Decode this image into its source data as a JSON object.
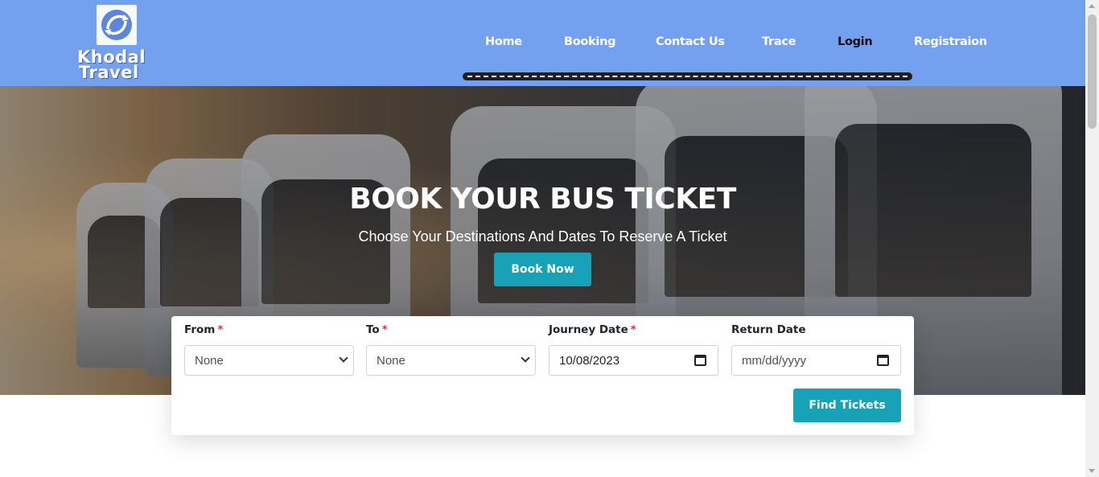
{
  "brand": {
    "name_line1": "Khodal",
    "name_line2": "Travel",
    "logo_icon": "swirl-arrows-icon"
  },
  "nav": {
    "items": [
      {
        "label": "Home"
      },
      {
        "label": "Booking"
      },
      {
        "label": "Contact Us"
      },
      {
        "label": "Trace"
      },
      {
        "label": "Login",
        "active": true
      },
      {
        "label": "Registraion"
      }
    ]
  },
  "hero": {
    "title": "BOOK YOUR BUS TICKET",
    "subtitle": "Choose Your Destinations And Dates To Reserve A Ticket",
    "cta_label": "Book Now"
  },
  "search": {
    "from": {
      "label": "From",
      "required_mark": "*",
      "value": "None"
    },
    "to": {
      "label": "To",
      "required_mark": "*",
      "value": "None"
    },
    "journey_date": {
      "label": "Journey Date",
      "required_mark": "*",
      "value": "10/08/2023"
    },
    "return_date": {
      "label": "Return Date",
      "value": "mm/dd/yyyy"
    },
    "submit_label": "Find Tickets"
  },
  "colors": {
    "header_bg": "#74a0f0",
    "accent": "#17a2b8",
    "required": "#dc3545"
  }
}
